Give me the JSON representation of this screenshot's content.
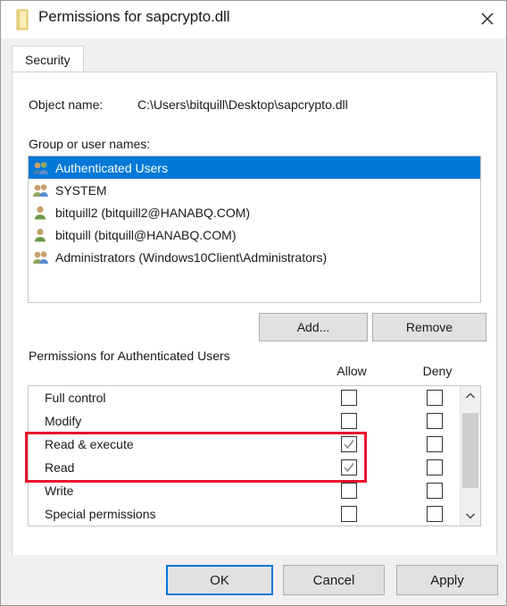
{
  "window": {
    "title": "Permissions for sapcrypto.dll",
    "icon": "file-properties-icon",
    "close_label": "✕"
  },
  "tabs": [
    {
      "label": "Security",
      "active": true
    }
  ],
  "object": {
    "label": "Object name:",
    "value": "C:\\Users\\bitquill\\Desktop\\sapcrypto.dll"
  },
  "group_list": {
    "label": "Group or user names:",
    "items": [
      {
        "name": "Authenticated Users",
        "icon": "group-icon",
        "selected": true
      },
      {
        "name": "SYSTEM",
        "icon": "group-icon",
        "selected": false
      },
      {
        "name": "bitquill2 (bitquill2@HANABQ.COM)",
        "icon": "user-icon",
        "selected": false
      },
      {
        "name": "bitquill (bitquill@HANABQ.COM)",
        "icon": "user-icon",
        "selected": false
      },
      {
        "name": "Administrators (Windows10Client\\Administrators)",
        "icon": "group-icon",
        "selected": false
      }
    ]
  },
  "actions": {
    "add_label": "Add...",
    "remove_label": "Remove"
  },
  "permissions": {
    "label": "Permissions for Authenticated Users",
    "columns": {
      "allow": "Allow",
      "deny": "Deny"
    },
    "rows": [
      {
        "name": "Full control",
        "allow": false,
        "deny": false,
        "highlighted": false
      },
      {
        "name": "Modify",
        "allow": false,
        "deny": false,
        "highlighted": false
      },
      {
        "name": "Read & execute",
        "allow": true,
        "deny": false,
        "highlighted": true
      },
      {
        "name": "Read",
        "allow": true,
        "deny": false,
        "highlighted": true
      },
      {
        "name": "Write",
        "allow": false,
        "deny": false,
        "highlighted": false
      },
      {
        "name": "Special permissions",
        "allow": false,
        "deny": false,
        "highlighted": false
      }
    ],
    "scroll_up": "˄",
    "scroll_down": "˅"
  },
  "annotation": {
    "color": "#e8112d",
    "targets": [
      "Read & execute",
      "Read"
    ]
  },
  "footer": {
    "ok_label": "OK",
    "cancel_label": "Cancel",
    "apply_label": "Apply"
  },
  "colors": {
    "selection": "#0078d7",
    "dialog_bg": "#f0f0f0",
    "panel_bg": "#ffffff",
    "annotation_red": "#e8112d"
  }
}
